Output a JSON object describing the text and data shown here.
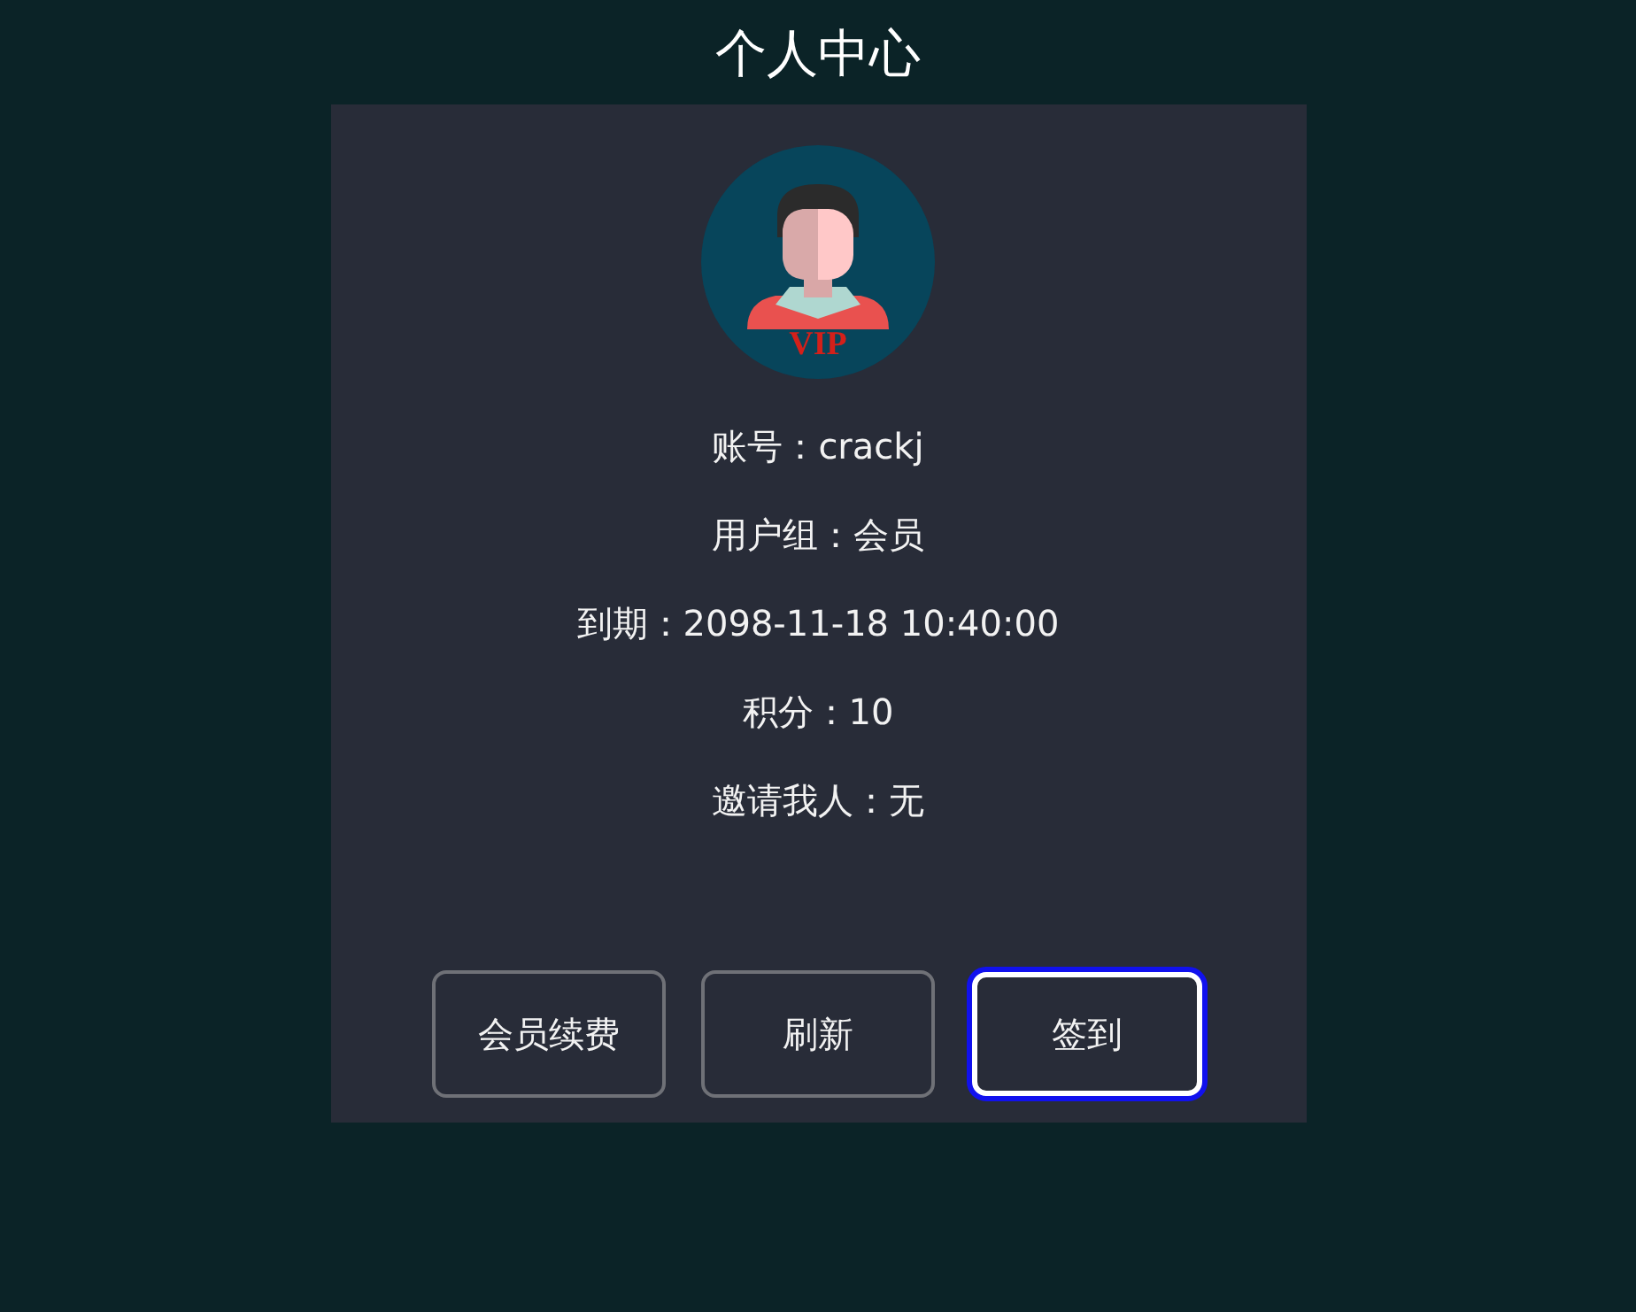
{
  "window": {
    "title": "个人中心"
  },
  "avatar": {
    "badge": "VIP"
  },
  "info": [
    "账号：crackj",
    "用户组：会员",
    "到期：2098-11-18 10:40:00",
    "积分：10",
    "邀请我人：无"
  ],
  "buttons": [
    {
      "label": "会员续费",
      "focused": false
    },
    {
      "label": "刷新",
      "focused": false
    },
    {
      "label": "签到",
      "focused": true
    }
  ]
}
